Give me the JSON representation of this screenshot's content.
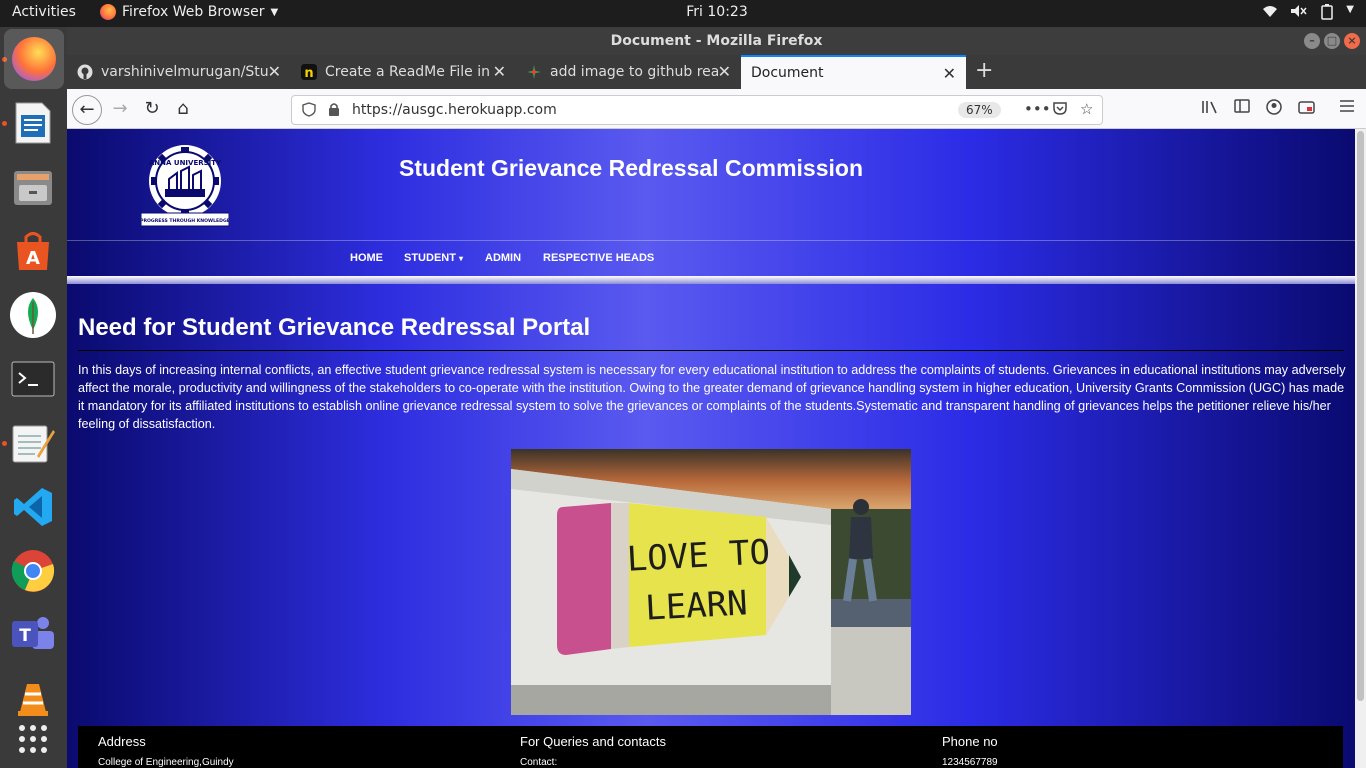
{
  "topbar": {
    "activities": "Activities",
    "app_name": "Firefox Web Browser",
    "clock": "Fri 10:23"
  },
  "window": {
    "title": "Document - Mozilla Firefox"
  },
  "tabs": [
    {
      "label": "varshinivelmurugan/Stud",
      "icon": "github-icon"
    },
    {
      "label": "Create a ReadMe File in G",
      "icon": "n-logo-icon"
    },
    {
      "label": "add image to github read",
      "icon": "google-icon"
    },
    {
      "label": "Document",
      "icon": "none"
    }
  ],
  "navbar": {
    "url": "https://ausgc.herokuapp.com",
    "zoom": "67%"
  },
  "site": {
    "title": "Student Grievance Redressal Commission",
    "logo_text": "ANNA UNIVERSITY",
    "logo_motto": "PROGRESS THROUGH KNOWLEDGE",
    "nav": [
      "HOME",
      "STUDENT",
      "ADMIN",
      "RESPECTIVE HEADS"
    ],
    "student_caret": "▾",
    "heading": "Need for Student Grievance Redressal Portal",
    "paragraph": "In this days of increasing internal conflicts, an effective student grievance redressal system is necessary for every educational institution to address the complaints of students. Grievances in educational institutions may adversely affect the morale, productivity and willingness of the stakeholders to co-operate with the institution. Owing to the greater demand of grievance handling system in higher education, University Grants Commission (UGC) has made it mandatory for its affiliated institutions to establish online grievance redressal system to solve the grievances or complaints of the students.Systematic and transparent handling of grievances helps the petitioner relieve his/her feeling of dissatisfaction.",
    "image_sign_line1": "LOVE TO",
    "image_sign_line2": "LEARN"
  },
  "footer": {
    "address_heading": "Address",
    "address_value": "College of Engineering,Guindy",
    "queries_heading": "For Queries and contacts",
    "queries_value": "Contact:",
    "phone_heading": "Phone no",
    "phone_value": "1234567789"
  },
  "colors": {
    "page_bg_center": "#5a5af0",
    "page_bg_edge": "#0a0a6e",
    "firefox_accent": "#0a84ff",
    "ubuntu_accent": "#e95420"
  }
}
